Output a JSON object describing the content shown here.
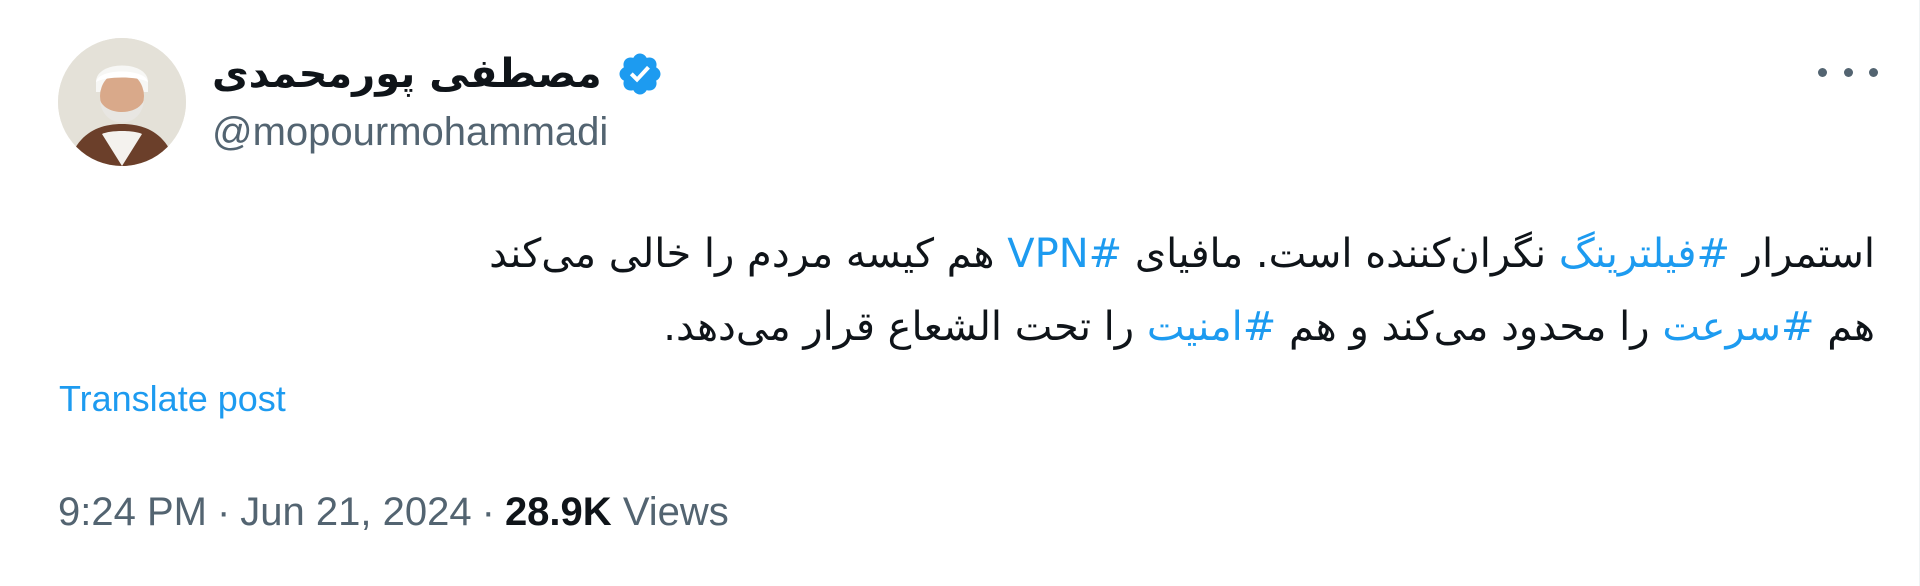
{
  "author": {
    "display_name": "مصطفی پورمحمدی",
    "handle": "@mopourmohammadi",
    "verified": true,
    "avatar_icon": "profile-photo"
  },
  "tweet": {
    "line1": {
      "p1": "استمرار ",
      "tag1": "#فیلترینگ",
      "p2": " نگران‌کننده است. مافیای ",
      "tag2": "#VPN",
      "p3": " هم کیسه مردم را خالی می‌کند"
    },
    "line2": {
      "p1": "هم ",
      "tag1": "#سرعت",
      "p2": " را محدود می‌کند و هم ",
      "tag2": "#امنیت",
      "p3": " را تحت الشعاع قرار می‌دهد."
    }
  },
  "translate_label": "Translate post",
  "meta": {
    "time": "9:24 PM",
    "date": "Jun 21, 2024",
    "separator": "·",
    "views_count": "28.9K",
    "views_label": "Views"
  },
  "colors": {
    "text": "#0f1419",
    "secondary": "#536471",
    "link": "#1d9bf0",
    "verified": "#1d9bf0"
  }
}
